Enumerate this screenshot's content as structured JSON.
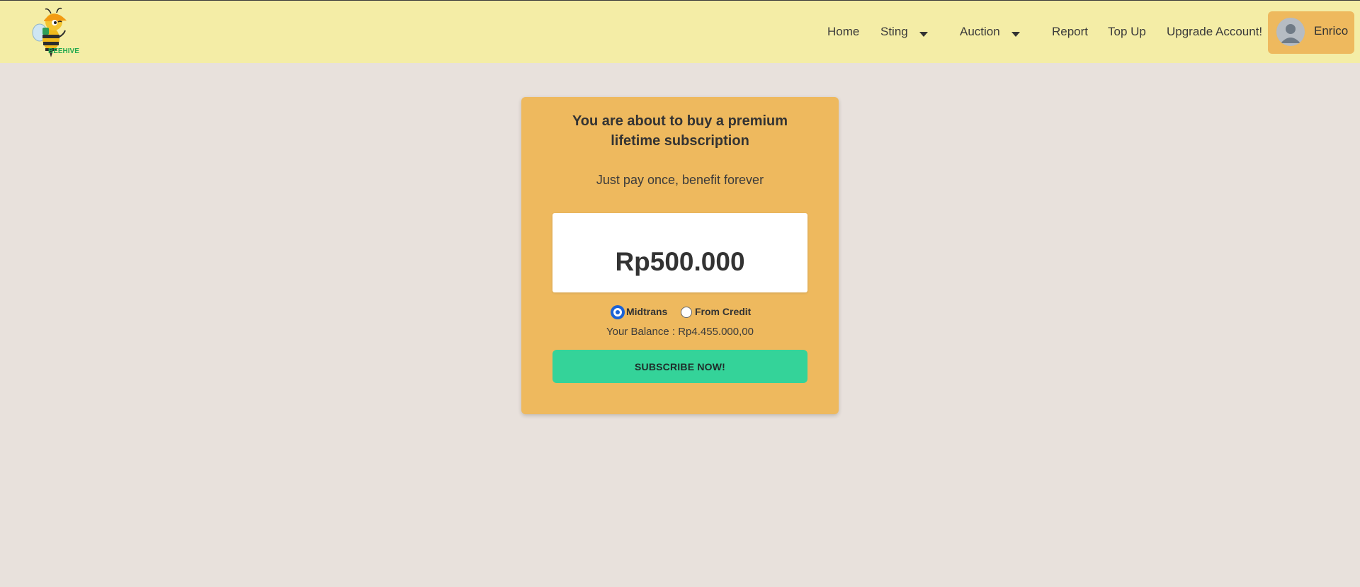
{
  "navbar": {
    "logo_text": "BEEHIVE",
    "links": {
      "home": "Home",
      "sting": "Sting",
      "auction": "Auction",
      "report": "Report",
      "top_up": "Top Up",
      "upgrade": "Upgrade Account!"
    },
    "profile": {
      "name": "Enrico"
    }
  },
  "card": {
    "title": "You are about to buy a premium lifetime subscription",
    "subtitle": "Just pay once, benefit forever",
    "price": "Rp500.000",
    "payment_options": [
      {
        "label": "Midtrans",
        "selected": true
      },
      {
        "label": "From Credit",
        "selected": false
      }
    ],
    "balance": "Your Balance : Rp4.455.000,00",
    "subscribe_label": "SUBSCRIBE NOW!"
  },
  "colors": {
    "navbar_bg": "#f4eda6",
    "page_bg": "#e8e1dc",
    "card_bg": "#eeb95e",
    "button_bg": "#34d399",
    "radio_accent": "#1a62d6"
  },
  "icons": [
    "bee-logo",
    "caret-down-icon",
    "user-avatar-icon"
  ]
}
